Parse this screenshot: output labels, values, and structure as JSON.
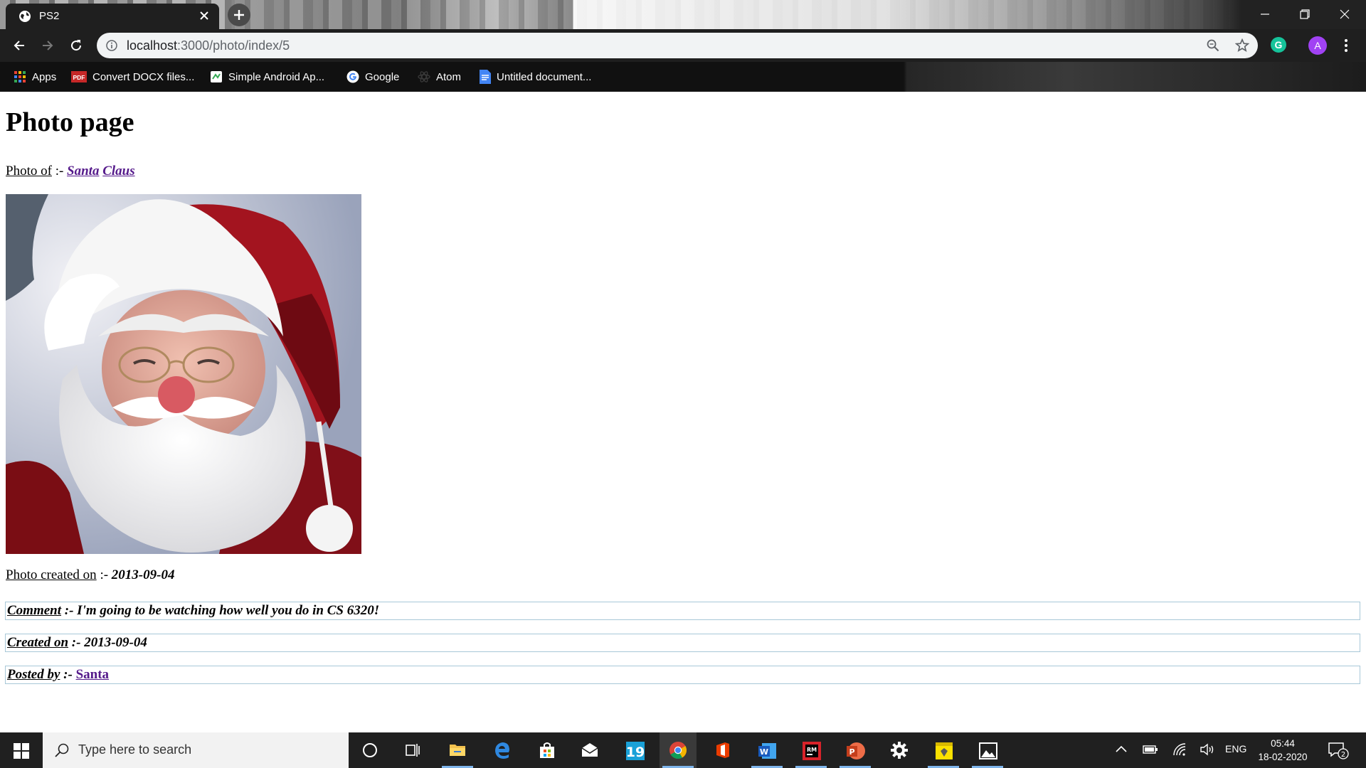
{
  "browser": {
    "tab_title": "PS2",
    "url_host": "localhost",
    "url_path": ":3000/photo/index/5",
    "avatar_letter": "A",
    "extension_letter": "G",
    "bookmarks": [
      {
        "label": "Apps",
        "icon": "apps-grid-icon"
      },
      {
        "label": "Convert DOCX files...",
        "icon": "pdf-icon"
      },
      {
        "label": "Simple Android Ap...",
        "icon": "android-doc-icon"
      },
      {
        "label": "Google",
        "icon": "google-icon"
      },
      {
        "label": "Atom",
        "icon": "atom-icon"
      },
      {
        "label": "Untitled document...",
        "icon": "google-docs-icon"
      }
    ]
  },
  "page": {
    "heading": "Photo page",
    "photo_of_label": "Photo of",
    "separator": " :- ",
    "first_name": "Santa",
    "last_name": "Claus",
    "created_label": "Photo created on",
    "created_value": "2013-09-04",
    "comment": {
      "comment_label": "Comment",
      "comment_text": "I'm going to be watching how well you do in CS 6320!",
      "created_label": "Created on",
      "created_value": "2013-09-04",
      "posted_label": "Posted by",
      "posted_value": "Santa"
    }
  },
  "taskbar": {
    "search_placeholder": "Type here to search",
    "language": "ENG",
    "time": "05:44",
    "date": "18-02-2020",
    "notification_count": "2",
    "pinned_apps": [
      "cortana",
      "task-view",
      "file-explorer",
      "edge",
      "store",
      "mail",
      "19",
      "chrome",
      "office",
      "word",
      "rubymine",
      "powerpoint",
      "settings",
      "sticky-notes",
      "photos"
    ]
  },
  "colors": {
    "link_visited": "#551a8b",
    "taskbar_bg": "#202020",
    "chrome_toolbar": "#1f1f1f",
    "comment_border": "#a8c8d8"
  }
}
